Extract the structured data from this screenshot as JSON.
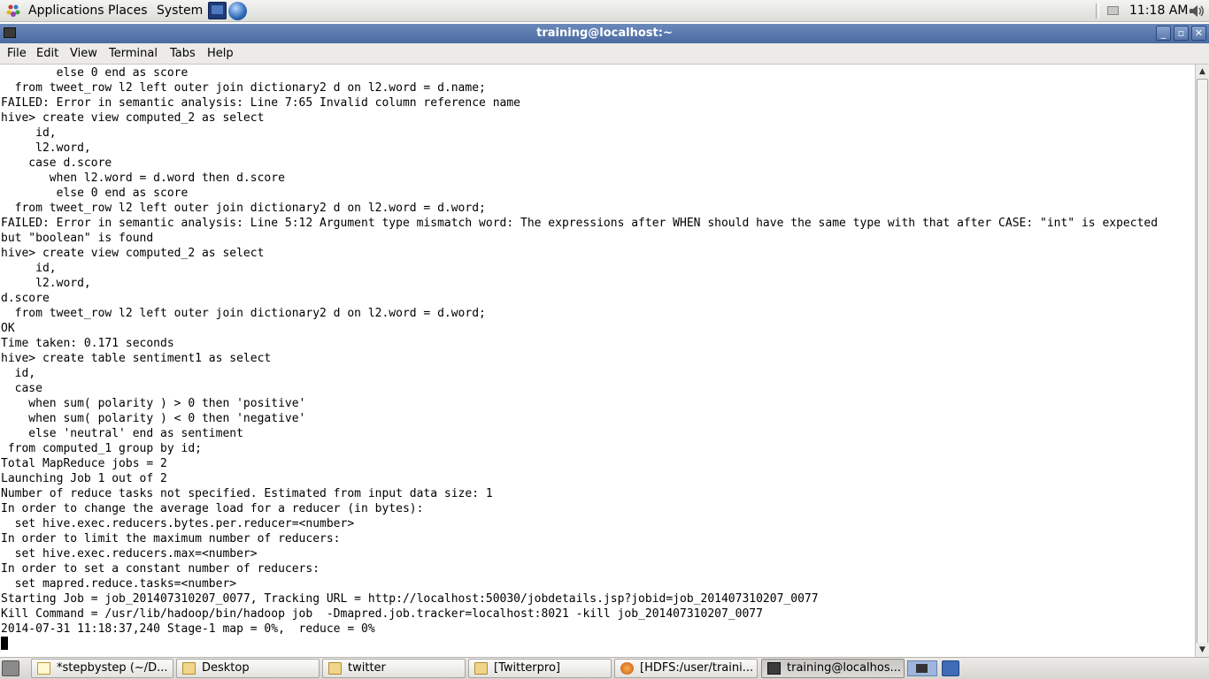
{
  "top_panel": {
    "menus": [
      "Applications",
      "Places",
      "System"
    ],
    "clock": "11:18 AM"
  },
  "window": {
    "title": "training@localhost:~",
    "controls": {
      "minimize": "_",
      "maximize": "▫",
      "close": "✕"
    }
  },
  "menubar": {
    "items": [
      "File",
      "Edit",
      "View",
      "Terminal",
      "Tabs",
      "Help"
    ]
  },
  "terminal": {
    "lines": [
      "        else 0 end as score",
      "  from tweet_row l2 left outer join dictionary2 d on l2.word = d.name;",
      "FAILED: Error in semantic analysis: Line 7:65 Invalid column reference name",
      "hive> create view computed_2 as select",
      "     id,",
      "     l2.word,",
      "    case d.score",
      "       when l2.word = d.word then d.score",
      "        else 0 end as score",
      "  from tweet_row l2 left outer join dictionary2 d on l2.word = d.word;",
      "FAILED: Error in semantic analysis: Line 5:12 Argument type mismatch word: The expressions after WHEN should have the same type with that after CASE: \"int\" is expected",
      "but \"boolean\" is found",
      "hive> create view computed_2 as select",
      "     id,",
      "     l2.word,",
      "d.score",
      "  from tweet_row l2 left outer join dictionary2 d on l2.word = d.word;",
      "OK",
      "Time taken: 0.171 seconds",
      "hive> create table sentiment1 as select",
      "  id,",
      "  case",
      "    when sum( polarity ) > 0 then 'positive'",
      "    when sum( polarity ) < 0 then 'negative'",
      "    else 'neutral' end as sentiment",
      " from computed_1 group by id;",
      "Total MapReduce jobs = 2",
      "Launching Job 1 out of 2",
      "Number of reduce tasks not specified. Estimated from input data size: 1",
      "In order to change the average load for a reducer (in bytes):",
      "  set hive.exec.reducers.bytes.per.reducer=<number>",
      "In order to limit the maximum number of reducers:",
      "  set hive.exec.reducers.max=<number>",
      "In order to set a constant number of reducers:",
      "  set mapred.reduce.tasks=<number>",
      "Starting Job = job_201407310207_0077, Tracking URL = http://localhost:50030/jobdetails.jsp?jobid=job_201407310207_0077",
      "Kill Command = /usr/lib/hadoop/bin/hadoop job  -Dmapred.job.tracker=localhost:8021 -kill job_201407310207_0077",
      "2014-07-31 11:18:37,240 Stage-1 map = 0%,  reduce = 0%"
    ]
  },
  "taskbar": {
    "tasks": [
      {
        "label": "*stepbystep (~/D...",
        "icon": "text-editor-icon",
        "active": false
      },
      {
        "label": "Desktop",
        "icon": "folder-icon",
        "active": false
      },
      {
        "label": "twitter",
        "icon": "folder-icon",
        "active": false
      },
      {
        "label": "[Twitterpro]",
        "icon": "folder-icon",
        "active": false
      },
      {
        "label": "[HDFS:/user/traini...",
        "icon": "firefox-icon",
        "active": false
      },
      {
        "label": "training@localhos...",
        "icon": "terminal-icon",
        "active": true
      }
    ]
  }
}
